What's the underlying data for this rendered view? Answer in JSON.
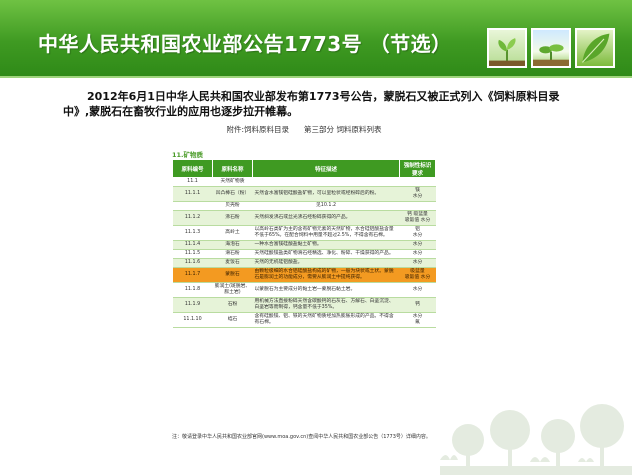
{
  "header": {
    "title": "中华人民共和国农业部公告1773号 （节选）"
  },
  "intro": "2012年6月1日中华人民共和国农业部发布第1773号公告，蒙脱石又被正式列入《饲料原料目录中》,蒙脱石在畜牧行业的应用也逐步拉开帷幕。",
  "document": {
    "heading": "附件:饲料原料目录　　第三部分  饲料原料列表",
    "section": "11.矿物质",
    "columns": [
      "原料编号",
      "原料名称",
      "特征描述",
      "强制性标识要求"
    ],
    "rows": [
      {
        "code": "11.1",
        "name": "天然矿物质",
        "desc": "",
        "req": "",
        "style": "odd"
      },
      {
        "code": "11.1.1",
        "name": "凹凸棒石（粉）",
        "desc": "天然含水富镁铝硅酸盐矿物，可以呈粒状或经粉碎后的粉。",
        "req": "镁\n水分",
        "style": "even"
      },
      {
        "code": "",
        "name": "贝壳粉",
        "desc": "见10.1.2",
        "req": "",
        "style": "odd"
      },
      {
        "code": "11.1.2",
        "name": "沸石粉",
        "desc": "天然斜发沸石或丝光沸石经粉碎获得的产品。",
        "req": "钙 吸蓝量\n吸氨值 水分",
        "style": "even"
      },
      {
        "code": "11.1.3",
        "name": "高岭土",
        "desc": "以高岭石类矿为主的含有矿物元素的天然矿物，水合硅铝酸盐含量不低于65%。在配合饲料中用量不超过2.5%，不得含有石棉。",
        "req": "铝\n水分",
        "style": "odd"
      },
      {
        "code": "11.1.4",
        "name": "海泡石",
        "desc": "一种水合富镁硅酸盐黏土矿物。",
        "req": "水分",
        "style": "even"
      },
      {
        "code": "11.1.5",
        "name": "滑石粉",
        "desc": "天然硅酸镁盐类矿物滑石经精选、净化、粉碎、干燥获得的产品。",
        "req": "水分",
        "style": "odd"
      },
      {
        "code": "11.1.6",
        "name": "麦饭石",
        "desc": "天然的无机硅铝酸盐。",
        "req": "水分",
        "style": "even"
      },
      {
        "code": "11.1.7",
        "name": "蒙脱石",
        "desc": "由颗粒极细的水合铝硅酸盐构成的矿物，一般为块状或土状。蒙脱石是膨润土的功能成分，需要从膨润土中提纯获得。",
        "req": "吸蓝量\n吸氨值 水分",
        "style": "highlight"
      },
      {
        "code": "11.1.8",
        "name": "膨润土(斑脱岩、膨土岩)",
        "desc": "以蒙脱石为主要成分的黏土岩一蒙脱石黏土岩。",
        "req": "水分",
        "style": "odd"
      },
      {
        "code": "11.1.9",
        "name": "石粉",
        "desc": "用机械方法直接粉碎天然含碳酸钙的石灰石、方解石、白垩沉淀、白垩岩等而制得，钙含量不低于35%。",
        "req": "钙",
        "style": "even"
      },
      {
        "code": "11.1.10",
        "name": "蛭石",
        "desc": "含有硅酸镁、铝、铁的天然矿物质经加热膨胀形成的产品。不得含有石棉。",
        "req": "水分\n氟",
        "style": "odd"
      }
    ],
    "note": "注：敬请登录中华人民共和国农业部官网(www.moa.gov.cn)查阅中华人民共和国农业部公告（1773号）详细内容。"
  },
  "colors": {
    "brand_green": "#3f9a22",
    "highlight_orange": "#f39a21",
    "row_alt": "#e6f3d8"
  },
  "icons": [
    "sprout-photo-icon",
    "seedling-photo-icon",
    "leaf-photo-icon",
    "tree-silhouette-decoration"
  ]
}
